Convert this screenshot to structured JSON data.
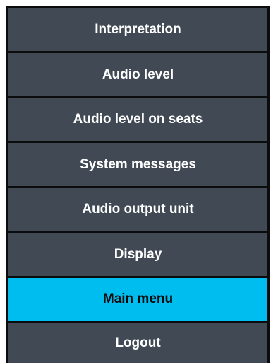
{
  "menu": {
    "items": [
      {
        "label": "Interpretation",
        "active": false
      },
      {
        "label": "Audio level",
        "active": false
      },
      {
        "label": "Audio level on seats",
        "active": false
      },
      {
        "label": "System messages",
        "active": false
      },
      {
        "label": "Audio output unit",
        "active": false
      },
      {
        "label": "Display",
        "active": false
      },
      {
        "label": "Main menu",
        "active": true
      },
      {
        "label": "Logout",
        "active": false
      }
    ]
  },
  "colors": {
    "item_background": "#414a54",
    "active_background": "#00bdf0",
    "separator": "#0b0c0e",
    "text": "#ffffff",
    "active_text": "#0a0a0a"
  }
}
